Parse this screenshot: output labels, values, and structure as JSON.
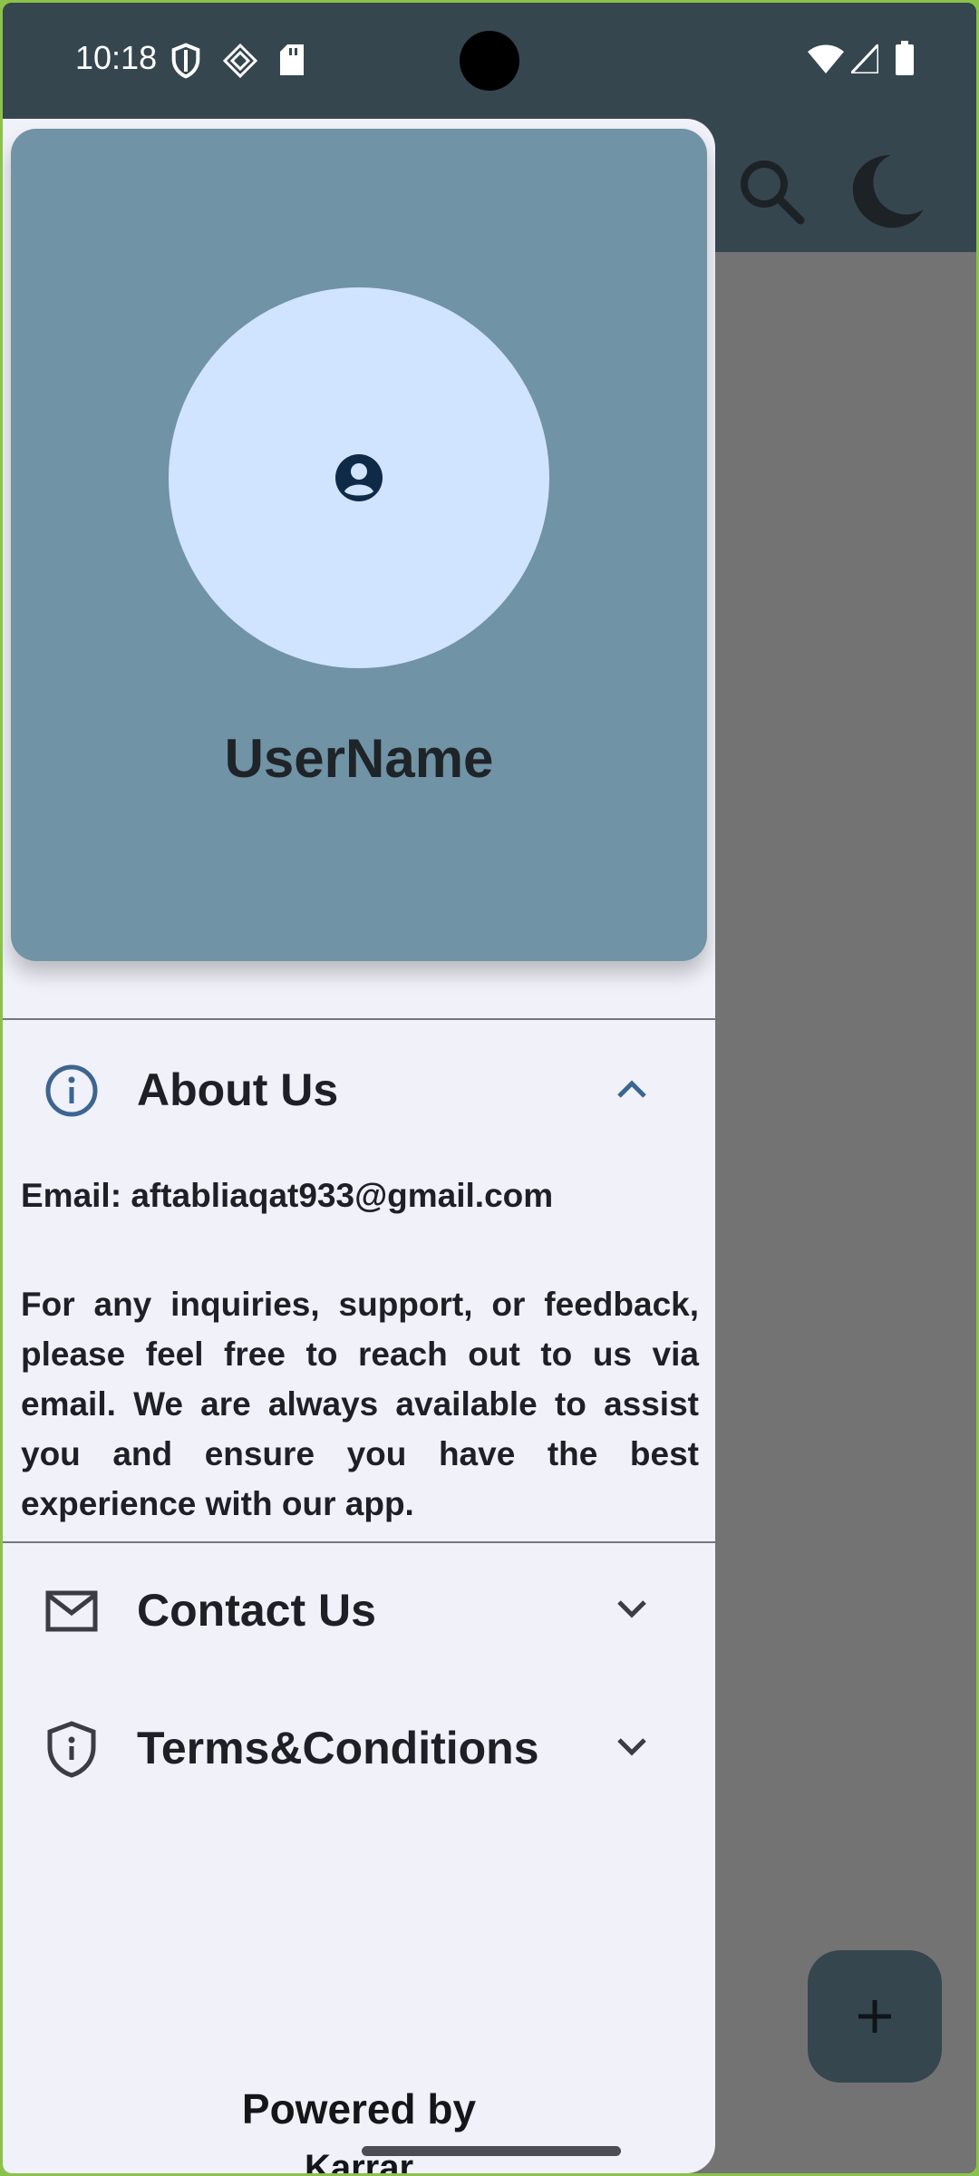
{
  "status_bar": {
    "time": "10:18",
    "left_icons": [
      "shield-icon",
      "vpn-key-icon",
      "sd-card-icon"
    ],
    "right_icons": [
      "wifi-icon",
      "cell-signal-icon",
      "battery-icon"
    ]
  },
  "app_bar": {
    "actions": [
      "search-icon",
      "moon-icon"
    ]
  },
  "drawer": {
    "profile": {
      "avatar_icon": "account-circle-icon",
      "username": "UserName"
    },
    "sections": [
      {
        "title": "About Us",
        "icon": "info-icon",
        "expanded": true,
        "email": "Email: aftabliaqat933@gmail.com",
        "body": "For any inquiries, support, or feedback, please feel free to reach out to us via email. We are always available to assist you and ensure you have the best experience with our app."
      },
      {
        "title": "Contact Us",
        "icon": "mail-icon",
        "expanded": false
      },
      {
        "title": "Terms&Conditions",
        "icon": "shield-icon",
        "expanded": false
      }
    ],
    "footer": {
      "powered_by": "Powered by",
      "name": "Karrar"
    }
  },
  "fab": {
    "icon": "plus-icon"
  },
  "colors": {
    "status_bar": "#35464f",
    "profile_card": "#7093a6",
    "avatar_bg": "#d1e4ff",
    "drawer_bg": "#f0f1f9",
    "accent": "#3c6590",
    "scrim": "#737374"
  }
}
